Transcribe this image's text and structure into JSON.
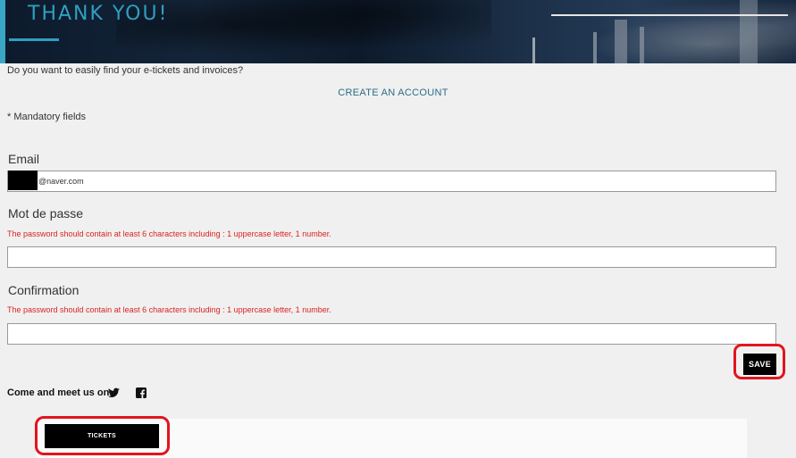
{
  "header": {
    "title": "THANK YOU!"
  },
  "account": {
    "prompt": "Do you want to easily find your e-tickets and invoices?",
    "create_link": "CREATE AN ACCOUNT",
    "mandatory_note": "* Mandatory fields"
  },
  "form": {
    "email": {
      "label": "Email",
      "value": "@naver.com"
    },
    "password": {
      "label": "Mot de passe",
      "hint": "The password should contain at least 6 characters including : 1 uppercase letter, 1 number.",
      "value": ""
    },
    "confirmation": {
      "label": "Confirmation",
      "hint": "The password should contain at least 6 characters including : 1 uppercase letter, 1 number.",
      "value": ""
    },
    "save_label": "SAVE"
  },
  "social": {
    "label": "Come and meet us on:",
    "icons": [
      "twitter-icon",
      "facebook-icon"
    ]
  },
  "tickets": {
    "button_label": "TICKETS"
  },
  "colors": {
    "accent": "#2f9fc1",
    "error": "#dd2222",
    "annotation_ring": "#e2141e",
    "button": "#000000"
  }
}
